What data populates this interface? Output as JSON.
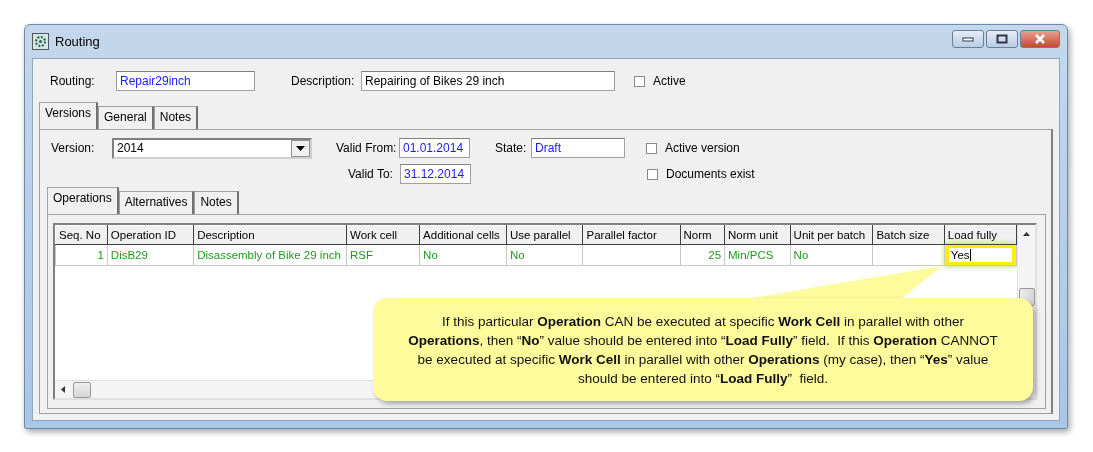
{
  "window": {
    "title": "Routing"
  },
  "header": {
    "routing_label": "Routing:",
    "routing_value": "Repair29inch",
    "description_label": "Description:",
    "description_value": "Repairing of Bikes 29 inch",
    "active": {
      "label": "Active",
      "checked": false
    }
  },
  "tabs": [
    {
      "label": "Versions",
      "selected": true
    },
    {
      "label": "General",
      "selected": false
    },
    {
      "label": "Notes",
      "selected": false
    }
  ],
  "version": {
    "version_label": "Version:",
    "version_value": "2014",
    "valid_from_label": "Valid From:",
    "valid_from": "01.01.2014",
    "valid_to_label": "Valid To:",
    "valid_to": "31.12.2014",
    "state_label": "State:",
    "state": "Draft",
    "checkboxes": [
      {
        "label": "Active version",
        "checked": false
      },
      {
        "label": "Documents exist",
        "checked": false
      }
    ]
  },
  "inner_tabs": [
    {
      "label": "Operations",
      "selected": true
    },
    {
      "label": "Alternatives",
      "selected": false
    },
    {
      "label": "Notes",
      "selected": false
    }
  ],
  "table": {
    "columns": [
      "Seq. No",
      "Operation ID",
      "Description",
      "Work cell",
      "Additional cells",
      "Use parallel",
      "Parallel factor",
      "Norm",
      "Norm unit",
      "Unit per batch",
      "Batch size",
      "Load fully"
    ],
    "rows": [
      {
        "cells": [
          {
            "text": "1",
            "highlighted": false
          },
          {
            "text": "DisB29",
            "highlighted": false
          },
          {
            "text": "Disassembly of Bike 29 inch",
            "highlighted": false
          },
          {
            "text": "RSF",
            "highlighted": false
          },
          {
            "text": "No",
            "highlighted": false
          },
          {
            "text": "No",
            "highlighted": false
          },
          {
            "text": "",
            "highlighted": false
          },
          {
            "text": "25",
            "highlighted": false
          },
          {
            "text": "Min/PCS",
            "highlighted": false
          },
          {
            "text": "No",
            "highlighted": false
          },
          {
            "text": "",
            "highlighted": false
          },
          {
            "text": "Yes",
            "highlighted": true
          }
        ]
      }
    ]
  },
  "callout": {
    "text": "If this particular **Operation** CAN be executed at specific **Work Cell** in parallel with other **Operations**, then “**No**” value should be entered into “**Load Fully**” field.  If this **Operation** CANNOT be executed at specific **Work Cell** in parallel with other **Operations** (my case), then “**Yes**” value should be entered into “**Load Fully**”  field."
  }
}
